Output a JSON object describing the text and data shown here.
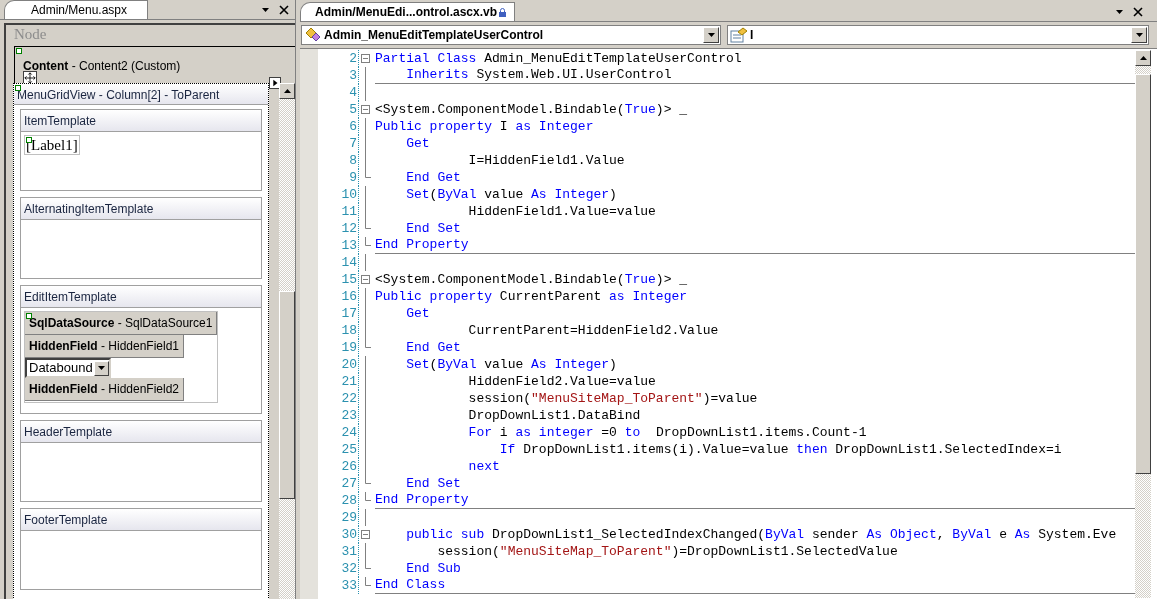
{
  "designer": {
    "tab": {
      "title": "Admin/Menu.aspx"
    },
    "node_label": "Node",
    "content_header": "**Content** - Content2 (Custom)",
    "grid_title": "MenuGridView - Column[2] - ToParent",
    "templates": [
      {
        "title": "ItemTemplate",
        "controls": [
          {
            "kind": "label",
            "text": "[Label1]"
          }
        ]
      },
      {
        "title": "AlternatingItemTemplate"
      },
      {
        "title": "EditItemTemplate",
        "controls": [
          {
            "kind": "component",
            "text": "**SqlDataSource** - SqlDataSource1"
          },
          {
            "kind": "component",
            "text": "**HiddenField** - HiddenField1"
          },
          {
            "kind": "dropdown",
            "text": "Databound"
          },
          {
            "kind": "component",
            "text": "**HiddenField** - HiddenField2"
          }
        ]
      },
      {
        "title": "HeaderTemplate"
      },
      {
        "title": "FooterTemplate"
      }
    ]
  },
  "editor": {
    "tab": {
      "title": "Admin/MenuEdi...ontrol.ascx.vb",
      "locked": true
    },
    "class_dropdown": "Admin_MenuEditTemplateUserControl",
    "member_dropdown": "I",
    "lines": [
      {
        "num": "2",
        "kind": "fold-start",
        "tokens": [
          {
            "kind": "kw",
            "text": "Partial Class"
          },
          {
            "kind": "txt",
            "text": " Admin_MenuEditTemplateUserControl"
          }
        ]
      },
      {
        "num": "3",
        "kind": "inner",
        "separator": true,
        "tokens": [
          {
            "kind": "kw",
            "text": "    Inherits"
          },
          {
            "kind": "txt",
            "text": " System.Web.UI.UserControl"
          }
        ]
      },
      {
        "num": "4",
        "kind": "inner"
      },
      {
        "num": "5",
        "kind": "fold-start",
        "tokens": [
          {
            "kind": "txt",
            "text": "<System.ComponentModel.Bindable("
          },
          {
            "kind": "kw",
            "text": "True"
          },
          {
            "kind": "txt",
            "text": ")> _"
          }
        ]
      },
      {
        "num": "6",
        "kind": "inner",
        "tokens": [
          {
            "kind": "kw",
            "text": "Public property"
          },
          {
            "kind": "txt",
            "text": " I "
          },
          {
            "kind": "kw",
            "text": "as Integer"
          }
        ]
      },
      {
        "num": "7",
        "kind": "inner",
        "tokens": [
          {
            "kind": "kw",
            "text": "    Get"
          }
        ]
      },
      {
        "num": "8",
        "kind": "inner",
        "tokens": [
          {
            "kind": "txt",
            "text": "            I=HiddenField1.Value"
          }
        ]
      },
      {
        "num": "9",
        "kind": "fold-end",
        "tokens": [
          {
            "kind": "kw",
            "text": "    End Get"
          }
        ]
      },
      {
        "num": "10",
        "kind": "inner",
        "tokens": [
          {
            "kind": "kw",
            "text": "    Set"
          },
          {
            "kind": "txt",
            "text": "("
          },
          {
            "kind": "kw",
            "text": "ByVal"
          },
          {
            "kind": "txt",
            "text": " value "
          },
          {
            "kind": "kw",
            "text": "As Integer"
          },
          {
            "kind": "txt",
            "text": ")"
          }
        ]
      },
      {
        "num": "11",
        "kind": "inner",
        "tokens": [
          {
            "kind": "txt",
            "text": "            HiddenField1.Value=value"
          }
        ]
      },
      {
        "num": "12",
        "kind": "fold-end",
        "tokens": [
          {
            "kind": "kw",
            "text": "    End Set"
          }
        ]
      },
      {
        "num": "13",
        "kind": "fold-end",
        "separator": true,
        "tokens": [
          {
            "kind": "kw",
            "text": "End Property"
          }
        ]
      },
      {
        "num": "14",
        "kind": "inner"
      },
      {
        "num": "15",
        "kind": "fold-start",
        "tokens": [
          {
            "kind": "txt",
            "text": "<System.ComponentModel.Bindable("
          },
          {
            "kind": "kw",
            "text": "True"
          },
          {
            "kind": "txt",
            "text": ")> _"
          }
        ]
      },
      {
        "num": "16",
        "kind": "inner",
        "tokens": [
          {
            "kind": "kw",
            "text": "Public property"
          },
          {
            "kind": "txt",
            "text": " CurrentParent "
          },
          {
            "kind": "kw",
            "text": "as Integer"
          }
        ]
      },
      {
        "num": "17",
        "kind": "inner",
        "tokens": [
          {
            "kind": "kw",
            "text": "    Get"
          }
        ]
      },
      {
        "num": "18",
        "kind": "inner",
        "tokens": [
          {
            "kind": "txt",
            "text": "            CurrentParent=HiddenField2.Value"
          }
        ]
      },
      {
        "num": "19",
        "kind": "fold-end",
        "tokens": [
          {
            "kind": "kw",
            "text": "    End Get"
          }
        ]
      },
      {
        "num": "20",
        "kind": "inner",
        "tokens": [
          {
            "kind": "kw",
            "text": "    Set"
          },
          {
            "kind": "txt",
            "text": "("
          },
          {
            "kind": "kw",
            "text": "ByVal"
          },
          {
            "kind": "txt",
            "text": " value "
          },
          {
            "kind": "kw",
            "text": "As Integer"
          },
          {
            "kind": "txt",
            "text": ")"
          }
        ]
      },
      {
        "num": "21",
        "kind": "inner",
        "tokens": [
          {
            "kind": "txt",
            "text": "            HiddenField2.Value=value"
          }
        ]
      },
      {
        "num": "22",
        "kind": "inner",
        "tokens": [
          {
            "kind": "txt",
            "text": "            session("
          },
          {
            "kind": "str",
            "text": "\"MenuSiteMap_ToParent\""
          },
          {
            "kind": "txt",
            "text": ")=value"
          }
        ]
      },
      {
        "num": "23",
        "kind": "inner",
        "tokens": [
          {
            "kind": "txt",
            "text": "            DropDownList1.DataBind"
          }
        ]
      },
      {
        "num": "24",
        "kind": "inner",
        "tokens": [
          {
            "kind": "kw",
            "text": "            For"
          },
          {
            "kind": "txt",
            "text": " i "
          },
          {
            "kind": "kw",
            "text": "as integer"
          },
          {
            "kind": "txt",
            "text": " =0 "
          },
          {
            "kind": "kw",
            "text": "to"
          },
          {
            "kind": "txt",
            "text": "  DropDownList1.items.Count-1"
          }
        ]
      },
      {
        "num": "25",
        "kind": "inner",
        "tokens": [
          {
            "kind": "kw",
            "text": "                If"
          },
          {
            "kind": "txt",
            "text": " DropDownList1.items(i).Value=value "
          },
          {
            "kind": "kw",
            "text": "then"
          },
          {
            "kind": "txt",
            "text": " DropDownList1.SelectedIndex=i"
          }
        ]
      },
      {
        "num": "26",
        "kind": "inner",
        "tokens": [
          {
            "kind": "kw",
            "text": "            next"
          }
        ]
      },
      {
        "num": "27",
        "kind": "fold-end",
        "tokens": [
          {
            "kind": "kw",
            "text": "    End Set"
          }
        ]
      },
      {
        "num": "28",
        "kind": "fold-end",
        "separator": true,
        "tokens": [
          {
            "kind": "kw",
            "text": "End Property"
          }
        ]
      },
      {
        "num": "29",
        "kind": "inner"
      },
      {
        "num": "30",
        "kind": "fold-start",
        "tokens": [
          {
            "kind": "kw",
            "text": "    public sub"
          },
          {
            "kind": "txt",
            "text": " DropDownList1_SelectedIndexChanged("
          },
          {
            "kind": "kw",
            "text": "ByVal"
          },
          {
            "kind": "txt",
            "text": " sender "
          },
          {
            "kind": "kw",
            "text": "As Object"
          },
          {
            "kind": "txt",
            "text": ", "
          },
          {
            "kind": "kw",
            "text": "ByVal"
          },
          {
            "kind": "txt",
            "text": " e "
          },
          {
            "kind": "kw",
            "text": "As"
          },
          {
            "kind": "txt",
            "text": " System.Eve"
          }
        ]
      },
      {
        "num": "31",
        "kind": "inner",
        "tokens": [
          {
            "kind": "txt",
            "text": "        session("
          },
          {
            "kind": "str",
            "text": "\"MenuSiteMap_ToParent\""
          },
          {
            "kind": "txt",
            "text": ")=DropDownList1.SelectedValue"
          }
        ]
      },
      {
        "num": "32",
        "kind": "fold-end",
        "tokens": [
          {
            "kind": "kw",
            "text": "    End Sub"
          }
        ]
      },
      {
        "num": "33",
        "kind": "fold-end",
        "separator": true,
        "tokens": [
          {
            "kind": "kw",
            "text": "End Class"
          }
        ]
      }
    ]
  }
}
